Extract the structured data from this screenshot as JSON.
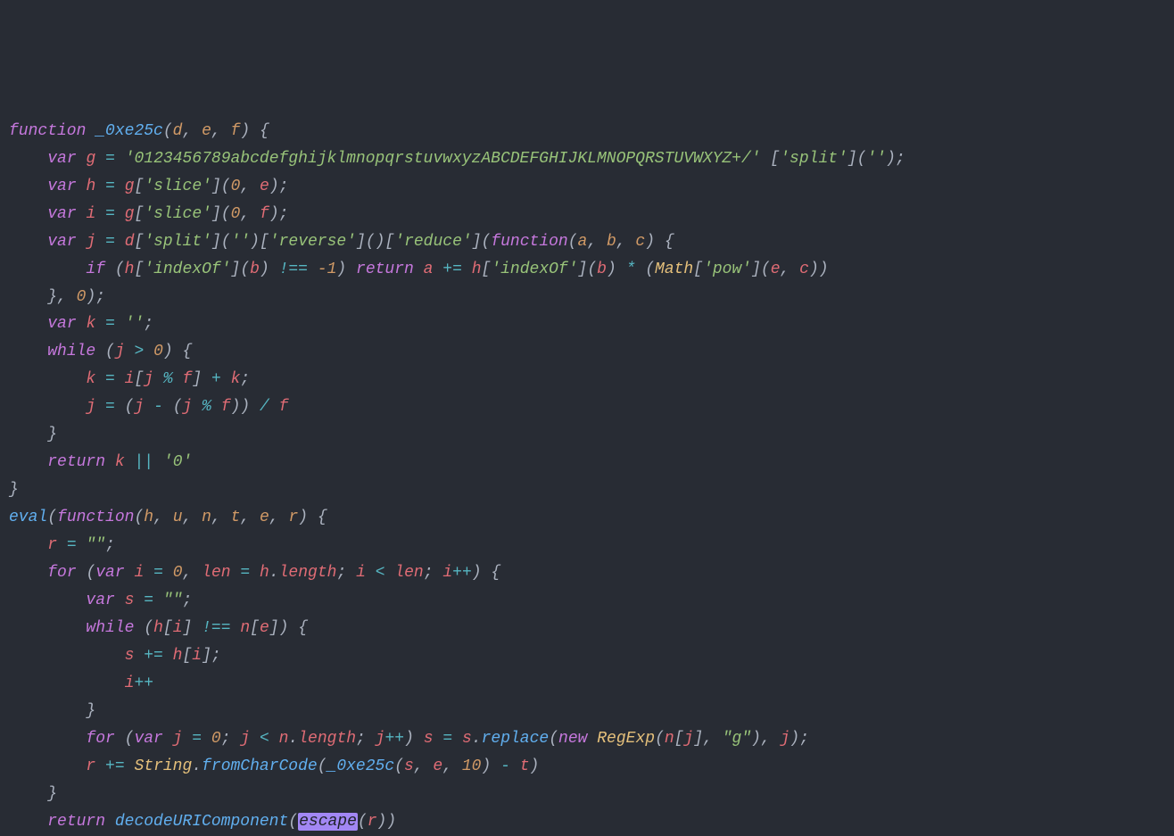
{
  "colors": {
    "background": "#282c34",
    "default": "#abb2bf",
    "keyword": "#c678dd",
    "function": "#61afef",
    "identifier": "#e06c75",
    "parameter": "#d19a66",
    "operator": "#56b6c2",
    "number": "#d19a66",
    "string": "#98c379",
    "class": "#e5c07b",
    "deprecated_bg": "#a287f4"
  },
  "t": {
    "function": "function",
    "fn_name": "_0xe25c",
    "var": "var",
    "if": "if",
    "return": "return",
    "while": "while",
    "for": "for",
    "new": "new",
    "eval": "eval",
    "d": "d",
    "e": "e",
    "f": "f",
    "g": "g",
    "h": "h",
    "i": "i",
    "j": "j",
    "k": "k",
    "u": "u",
    "n": "n",
    "t": "t",
    "r": "r",
    "a": "a",
    "b": "b",
    "c": "c",
    "s": "s",
    "len": "len",
    "Math": "Math",
    "String": "String",
    "RegExp": "RegExp",
    "alpha": "'0123456789abcdefghijklmnopqrstuvwxyzABCDEFGHIJKLMNOPQRSTUVWXYZ+/'",
    "split": "'split'",
    "empty": "''",
    "slice": "'slice'",
    "reverse": "'reverse'",
    "reduce": "'reduce'",
    "indexOf": "'indexOf'",
    "pow": "'pow'",
    "emptyk": "''",
    "zero_s": "'0'",
    "dq_empty": "\"\"",
    "dq_g": "\"g\"",
    "zero": "0",
    "neg1": "-1",
    "ten": "10",
    "length": "length",
    "replace": "replace",
    "fromCharCode": "fromCharCode",
    "decodeURIComponent": "decodeURIComponent",
    "escape": "escape",
    "eq": "=",
    "pluseq": "+=",
    "plus": "+",
    "minus": "-",
    "mult": "*",
    "div": "/",
    "mod": "%",
    "lt": "<",
    "gt": ">",
    "neq": "!==",
    "or": "||",
    "inc": "++",
    "semi": ";",
    "comma": ",",
    "dot": ".",
    "lp": "(",
    "rp": ")",
    "lb": "{",
    "rb": "}",
    "ls": "[",
    "rs": "]"
  }
}
